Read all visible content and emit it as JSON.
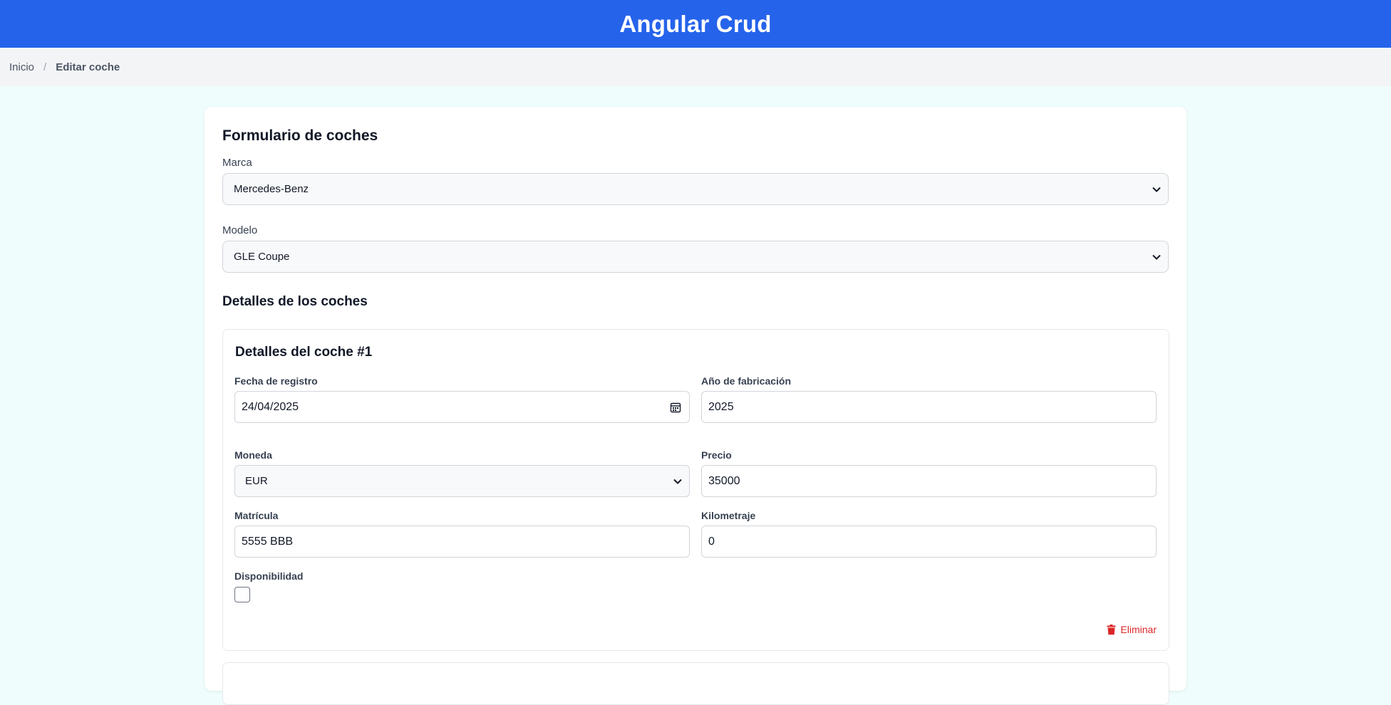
{
  "header": {
    "title": "Angular Crud"
  },
  "breadcrumb": {
    "home": "Inicio",
    "separator": "/",
    "current": "Editar coche"
  },
  "form": {
    "title": "Formulario de coches",
    "brand": {
      "label": "Marca",
      "value": "Mercedes-Benz"
    },
    "model": {
      "label": "Modelo",
      "value": "GLE Coupe"
    },
    "details_title": "Detalles de los coches",
    "cars": [
      {
        "title": "Detalles del coche #1",
        "registration_date": {
          "label": "Fecha de registro",
          "value": "24/04/2025"
        },
        "year": {
          "label": "Año de fabricación",
          "value": "2025"
        },
        "currency": {
          "label": "Moneda",
          "value": "EUR"
        },
        "price": {
          "label": "Precio",
          "value": "35000"
        },
        "plate": {
          "label": "Matrícula",
          "value": "5555 BBB"
        },
        "mileage": {
          "label": "Kilometraje",
          "value": "0"
        },
        "availability": {
          "label": "Disponibilidad",
          "checked": false
        },
        "delete_label": "Eliminar"
      }
    ]
  },
  "colors": {
    "header": "#2563eb",
    "danger": "#dc2626",
    "page_bg": "#f0fdfd"
  },
  "icons": {
    "calendar": "calendar-icon",
    "delete": "trash-icon",
    "select": "chevron-down-icon"
  }
}
